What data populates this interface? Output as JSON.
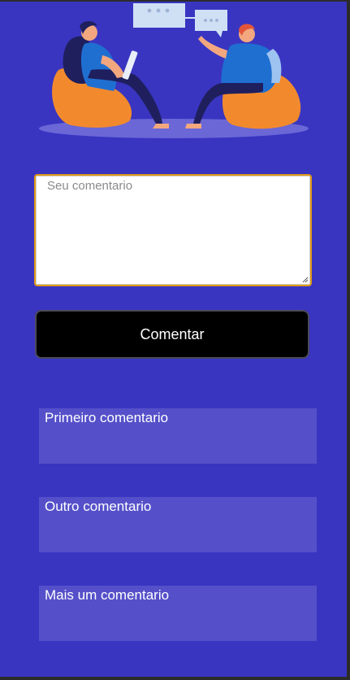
{
  "comment_form": {
    "placeholder": "Seu comentario",
    "submit_label": "Comentar"
  },
  "comments": [
    {
      "text": "Primeiro comentario"
    },
    {
      "text": "Outro comentario"
    },
    {
      "text": "Mais um comentario"
    }
  ],
  "colors": {
    "background": "#3935c1",
    "card": "#5550c9",
    "button": "#000000",
    "focus_outline": "#e09a16"
  },
  "illustration": {
    "icon": "people-talking-illustration"
  }
}
